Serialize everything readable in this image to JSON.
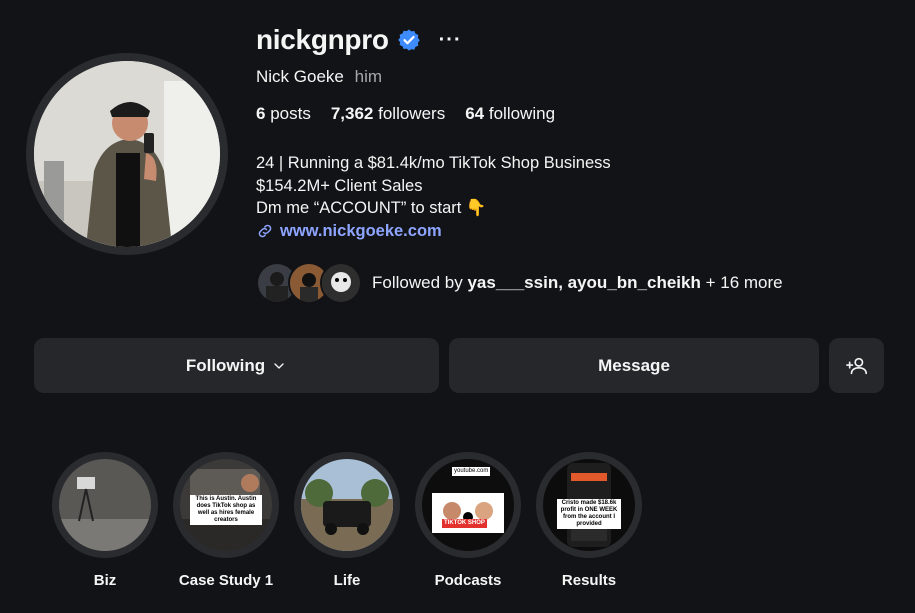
{
  "profile": {
    "username": "nickgnpro",
    "more": "···",
    "full_name": "Nick Goeke",
    "pronouns": "him",
    "stats": {
      "posts_count": "6",
      "posts_label": "posts",
      "followers_count": "7,362",
      "followers_label": "followers",
      "following_count": "64",
      "following_label": "following"
    },
    "bio": [
      "24 | Running a $81.4k/mo TikTok Shop Business",
      "$154.2M+ Client Sales",
      "Dm me “ACCOUNT” to start 👇"
    ],
    "website": "www.nickgoeke.com",
    "followed_by": {
      "prefix": "Followed by",
      "users": "yas___ssin, ayou_bn_cheikh",
      "suffix": "+ 16 more"
    }
  },
  "actions": {
    "following_label": "Following",
    "message_label": "Message"
  },
  "highlights": [
    {
      "label": "Biz"
    },
    {
      "label": "Case Study 1",
      "caption": "This is Austin. Austin does TikTok shop as well as hires female creators"
    },
    {
      "label": "Life"
    },
    {
      "label": "Podcasts",
      "caption": "TIKTOK SHOP",
      "site": "youtube.com"
    },
    {
      "label": "Results",
      "caption": "Cristo made $18.6k profit in ONE WEEK from the account I provided"
    }
  ],
  "colors": {
    "background": "#121316",
    "button": "#26272b",
    "link": "#8ea5ff",
    "verified": "#3d8bfd"
  },
  "icons": [
    "verified-badge-icon",
    "more-options-icon",
    "link-icon",
    "chevron-down-icon",
    "add-user-icon"
  ]
}
